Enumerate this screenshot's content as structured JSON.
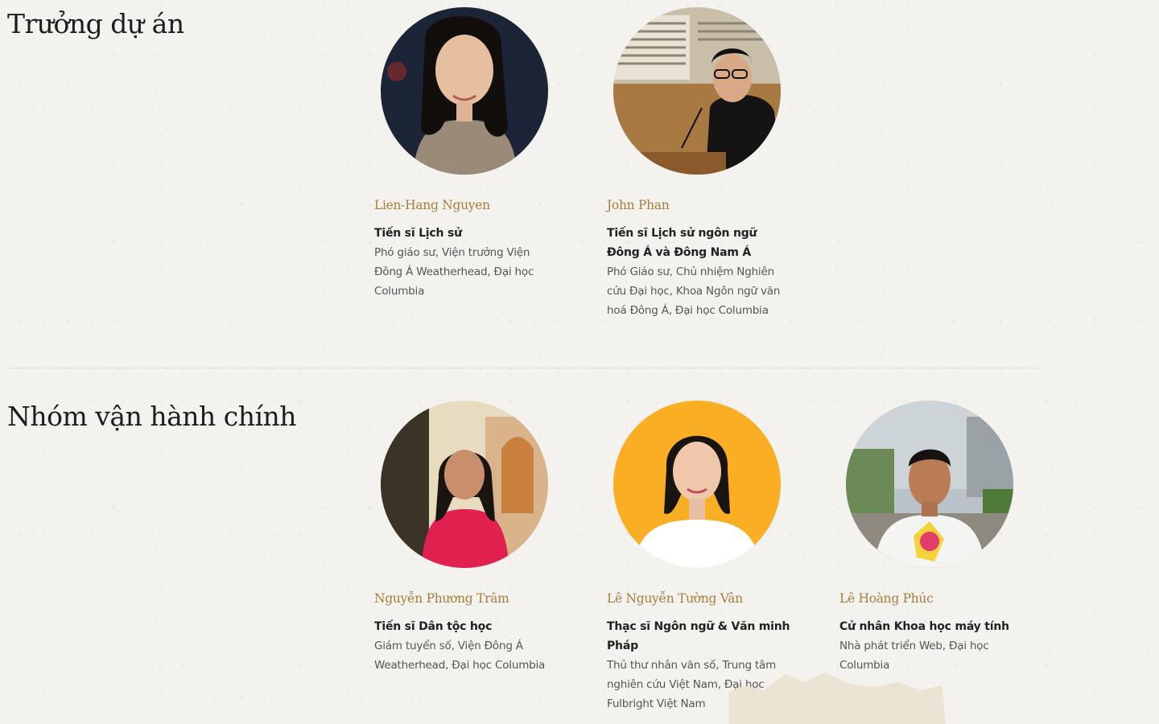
{
  "sections": [
    {
      "title": "Trưởng dự án",
      "members": [
        {
          "name": "Lien-Hang Nguyen",
          "degree": "Tiến sĩ Lịch sử",
          "role": "Phó giáo sư, Viện trưởng Viện Đông Á Weatherhead, Đại học Columbia"
        },
        {
          "name": "John Phan",
          "degree": "Tiến sĩ Lịch sử ngôn ngữ Đông Á và Đông Nam Á",
          "role": "Phó Giáo sư, Chủ nhiệm Nghiên cứu Đại học, Khoa Ngôn ngữ văn hoá Đông Á, Đại học Columbia"
        }
      ]
    },
    {
      "title": "Nhóm vận hành chính",
      "members": [
        {
          "name": "Nguyễn Phương Trâm",
          "degree": "Tiến sĩ Dân tộc học",
          "role": "Giám tuyển số, Viện Đông Á Weatherhead, Đại học Columbia"
        },
        {
          "name": "Lê Nguyễn Tường Vân",
          "degree": "Thạc sĩ Ngôn ngữ & Văn minh Pháp",
          "role": "Thủ thư nhân văn số, Trung tâm nghiên cứu Việt Nam, Đại học Fulbright Việt Nam"
        },
        {
          "name": "Lê Hoàng Phúc",
          "degree": "Cử nhân Khoa học máy tính",
          "role": "Nhà phát triển Web, Đại học Columbia"
        }
      ]
    }
  ],
  "colors": {
    "background": "#f3f2ee",
    "name_accent": "#a97d3b",
    "divider": "#e0ded8"
  }
}
